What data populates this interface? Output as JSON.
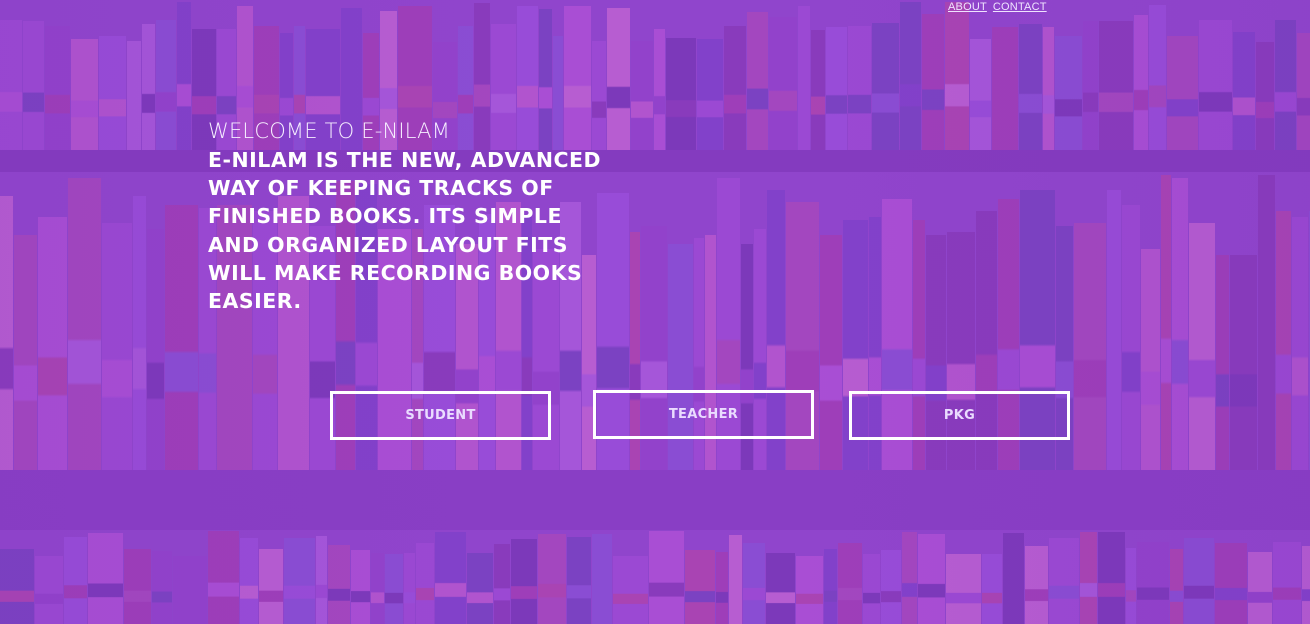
{
  "nav": {
    "about_label": "ABOUT",
    "contact_label": "CONTACT"
  },
  "hero": {
    "welcome": "WELCOME TO E-NILAM",
    "tagline": "E-NILAM IS THE NEW, ADVANCED WAY OF KEEPING TRACKS OF FINISHED BOOKS. ITS SIMPLE AND ORGANIZED LAYOUT FITS WILL MAKE RECORDING BOOKS EASIER."
  },
  "buttons": {
    "student_label": "STUDENT",
    "teacher_label": "TEACHER",
    "pkg_label": "PKG"
  },
  "colors": {
    "overlay": "#9646d2",
    "text": "#ffffff",
    "button_border": "#ffffff"
  }
}
